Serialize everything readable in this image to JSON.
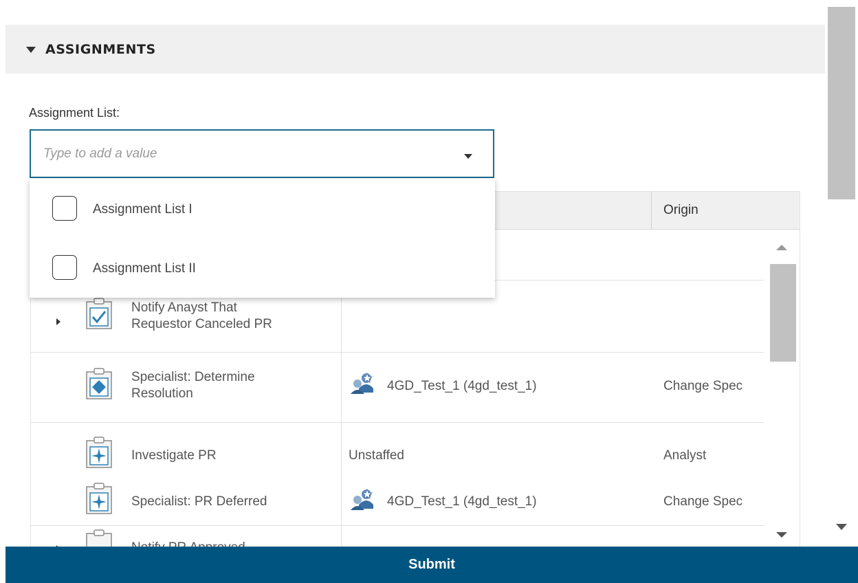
{
  "section": {
    "title": "ASSIGNMENTS"
  },
  "assignment_list": {
    "label": "Assignment List:",
    "placeholder": "Type to add a value",
    "options": [
      {
        "label": "Assignment List I",
        "checked": false
      },
      {
        "label": "Assignment List II",
        "checked": false
      }
    ]
  },
  "grid": {
    "columns": {
      "origin": "Origin"
    },
    "rows": [
      {
        "task": [
          "Notify Anayst That",
          "Requestor Canceled PR"
        ],
        "icon": "checkbox-task-icon",
        "assignee": "",
        "origin": ""
      },
      {
        "task": [
          "Specialist: Determine",
          "Resolution"
        ],
        "icon": "diamond-task-icon",
        "assignee": "4GD_Test_1 (4gd_test_1)",
        "origin": "Change Spec"
      },
      {
        "task": [
          "Investigate PR"
        ],
        "icon": "star-task-icon",
        "assignee": "Unstaffed",
        "origin": "Analyst"
      },
      {
        "task": [
          "Specialist: PR Deferred"
        ],
        "icon": "star-task-icon",
        "assignee": "4GD_Test_1 (4gd_test_1)",
        "origin": "Change Spec"
      },
      {
        "task": [
          "Notify PR Approved"
        ],
        "icon": "checkbox-task-icon",
        "assignee": "",
        "origin": ""
      }
    ]
  },
  "submit": {
    "label": "Submit"
  },
  "colors": {
    "accent": "#1a6d8f",
    "submit_bg": "#005580",
    "header_bg": "#f0f0f0"
  }
}
